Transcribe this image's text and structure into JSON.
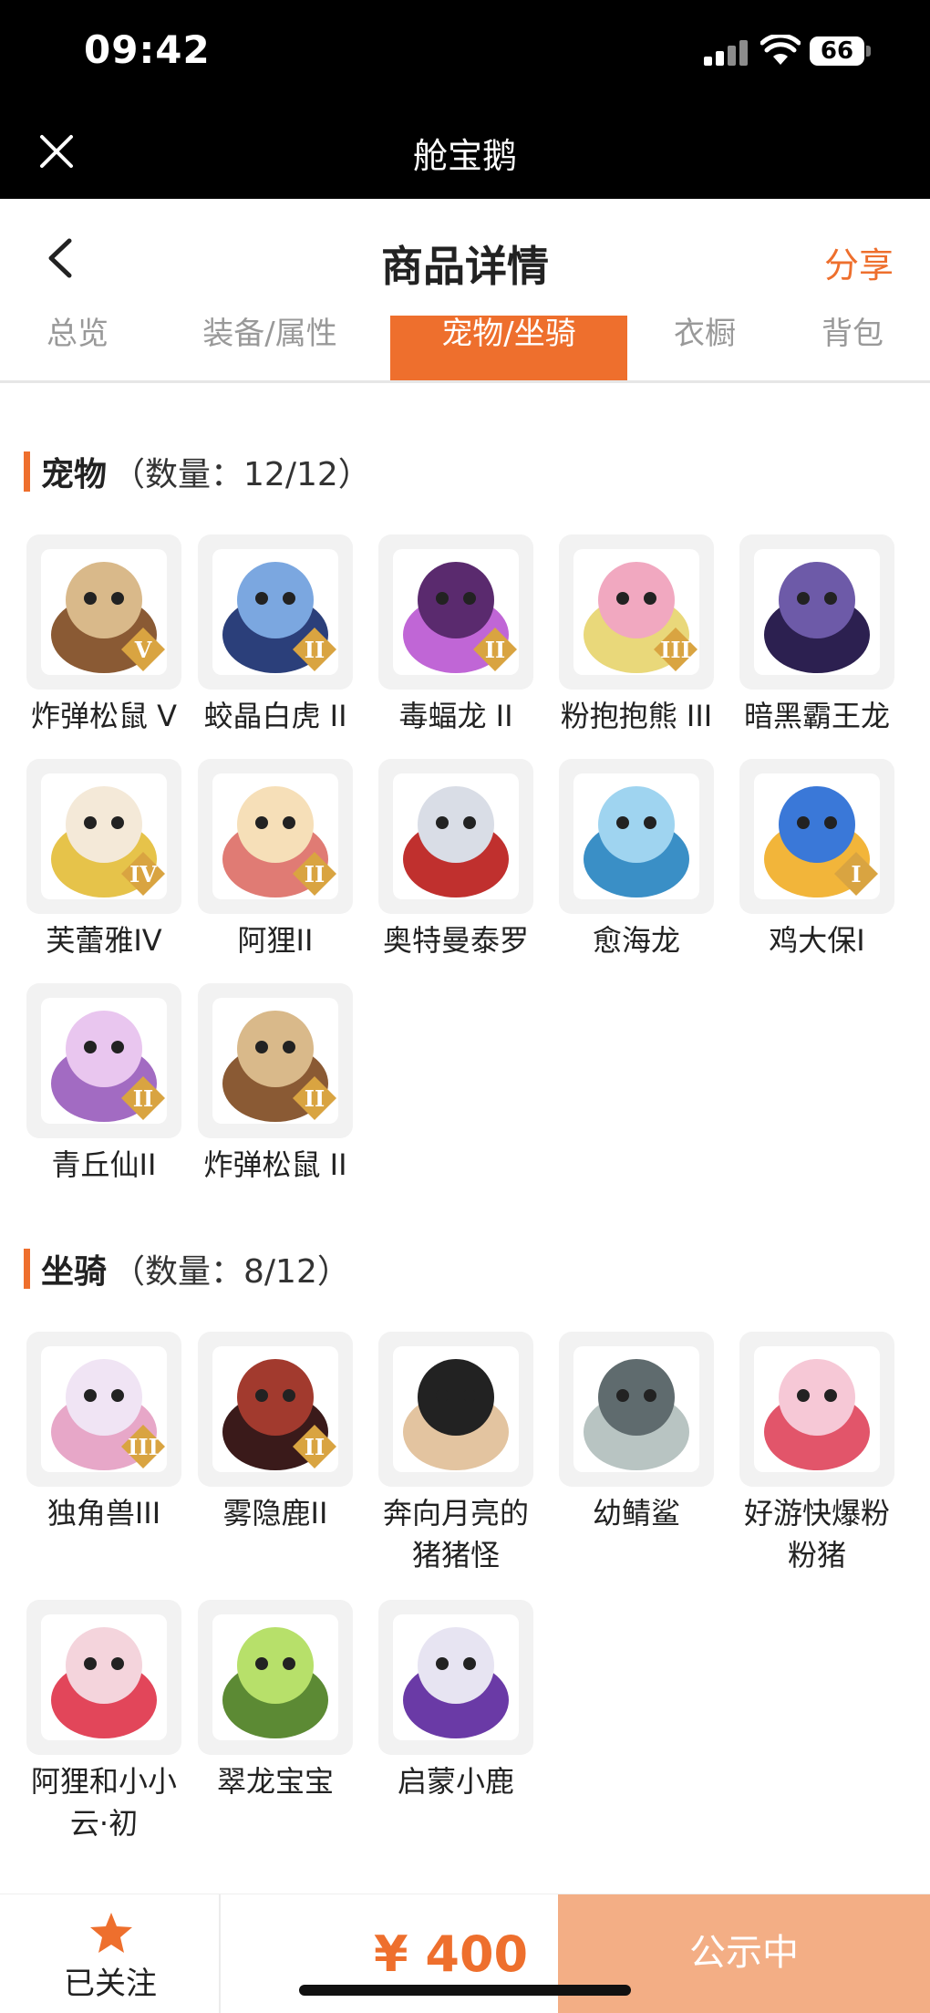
{
  "status_bar": {
    "time": "09:42",
    "battery": "66"
  },
  "app_bar": {
    "title": "舱宝鹅"
  },
  "header": {
    "title": "商品详情",
    "share": "分享"
  },
  "tabs": [
    {
      "label": "总览",
      "active": false
    },
    {
      "label": "装备/属性",
      "active": false
    },
    {
      "label": "宠物/坐骑",
      "active": true
    },
    {
      "label": "衣橱",
      "active": false
    },
    {
      "label": "背包",
      "active": false
    }
  ],
  "pets": {
    "title": "宠物",
    "count": "（数量：12/12）",
    "items": [
      {
        "name": "炸弹松鼠 V",
        "rank": "V"
      },
      {
        "name": "蛟晶白虎 II",
        "rank": "II"
      },
      {
        "name": "毒蝠龙 II",
        "rank": "II"
      },
      {
        "name": "粉抱抱熊 III",
        "rank": "III"
      },
      {
        "name": "暗黑霸王龙",
        "rank": ""
      },
      {
        "name": "芙蕾雅IV",
        "rank": "IV"
      },
      {
        "name": "阿狸II",
        "rank": "II"
      },
      {
        "name": "奥特曼泰罗",
        "rank": ""
      },
      {
        "name": "愈海龙",
        "rank": ""
      },
      {
        "name": "鸡大保I",
        "rank": "I"
      },
      {
        "name": "青丘仙II",
        "rank": "II"
      },
      {
        "name": "炸弹松鼠 II",
        "rank": "II"
      }
    ]
  },
  "mounts": {
    "title": "坐骑",
    "count": "（数量：8/12）",
    "items": [
      {
        "name": "独角兽III",
        "rank": "III"
      },
      {
        "name": "雾隐鹿II",
        "rank": "II"
      },
      {
        "name": "奔向月亮的猪猪怪",
        "rank": ""
      },
      {
        "name": "幼鲭鲨",
        "rank": ""
      },
      {
        "name": "好游快爆粉粉猪",
        "rank": ""
      },
      {
        "name": "阿狸和小小云·初",
        "rank": ""
      },
      {
        "name": "翠龙宝宝",
        "rank": ""
      },
      {
        "name": "启蒙小鹿",
        "rank": ""
      }
    ]
  },
  "bottom": {
    "follow": "已关注",
    "price": "¥ 400",
    "status": "公示中"
  },
  "colors": {
    "accent": "#ee6f2d",
    "status_button": "#f3ae85",
    "badge": "#d9a441"
  }
}
